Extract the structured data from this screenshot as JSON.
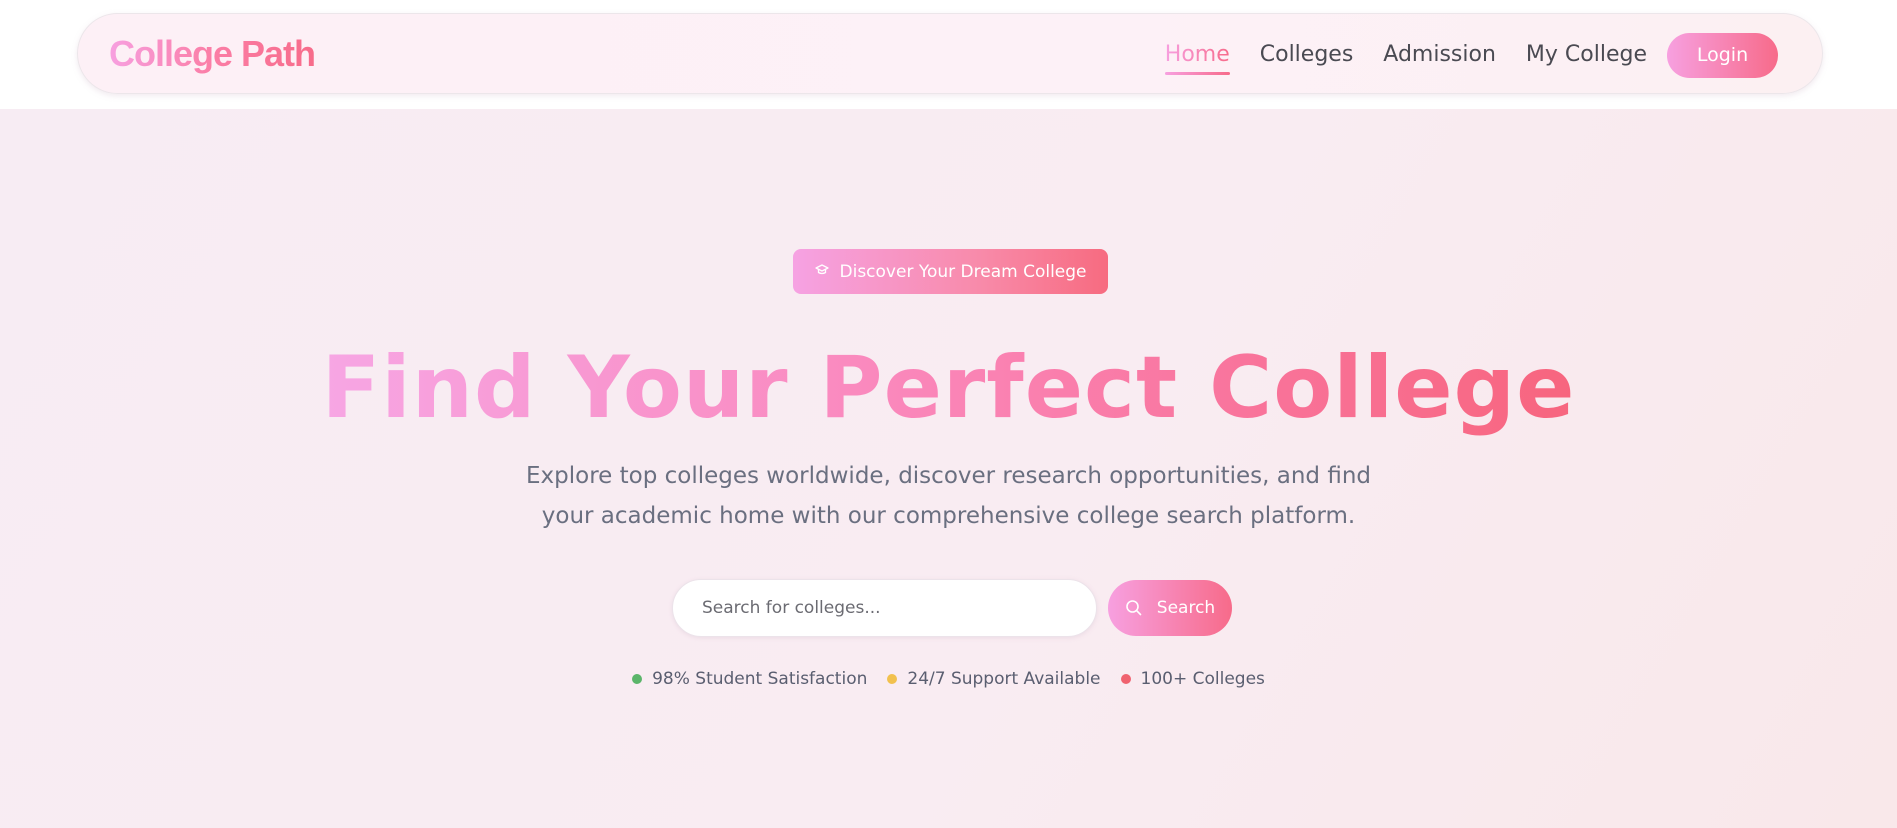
{
  "header": {
    "logo": "College Path",
    "nav": [
      {
        "label": "Home",
        "active": true
      },
      {
        "label": "Colleges",
        "active": false
      },
      {
        "label": "Admission",
        "active": false
      },
      {
        "label": "My College",
        "active": false
      }
    ],
    "login_label": "Login"
  },
  "hero": {
    "badge_icon": "graduation-cap-icon",
    "badge_label": "Discover Your Dream College",
    "title": "Find Your Perfect College",
    "subtitle_line1": "Explore top colleges worldwide, discover research opportunities, and find",
    "subtitle_line2": "your academic home with our comprehensive college search platform.",
    "search": {
      "placeholder": "Search for colleges...",
      "value": "",
      "button_label": "Search",
      "button_icon": "search-icon"
    },
    "stats": [
      {
        "label": "98% Student Satisfaction",
        "color": "#5bb56a"
      },
      {
        "label": "24/7 Support Available",
        "color": "#f2c14e"
      },
      {
        "label": "100+ Colleges",
        "color": "#f0626f"
      }
    ]
  },
  "colors": {
    "accent_start": "#f7a0e0",
    "accent_end": "#f76b8a",
    "text_muted": "#6a6f80"
  }
}
